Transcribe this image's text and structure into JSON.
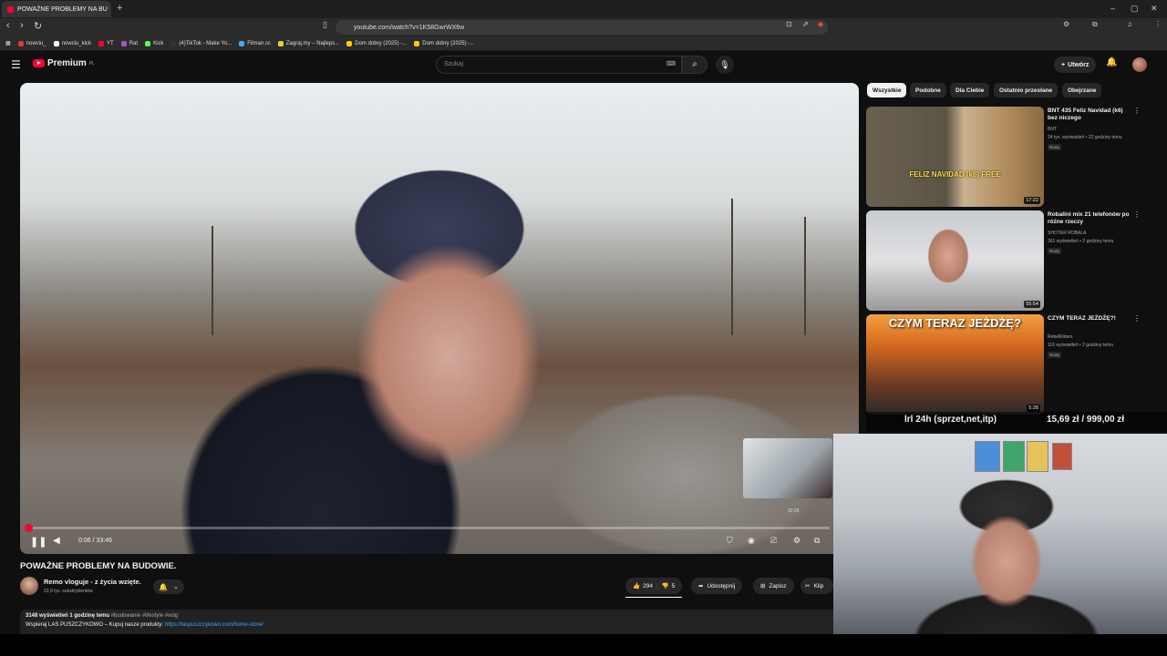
{
  "browser": {
    "tab_title": "POWAŻNE PROBLEMY NA BU",
    "url": "youtube.com/watch?v=1K58GwrWX6w",
    "bookmarks": [
      "nowciu_",
      "nowciu_kick",
      "YT",
      "Rat",
      "Kick",
      "(4)TikTok - Make Yo...",
      "Filman.cc",
      "Zagraj.my – Najleps...",
      "Dom dobry (2025) -...",
      "Dom dobry (2025) -..."
    ]
  },
  "header": {
    "logo_text": "Premium",
    "logo_region": "PL",
    "search_placeholder": "Szukaj",
    "create_label": "Utwórz"
  },
  "player": {
    "time": "0:06 / 33:46",
    "pip_duration": "32:25",
    "progress_fraction": 0.003
  },
  "video": {
    "title": "POWAŻNE PROBLEMY NA BUDOWIE.",
    "channel": "Remo vloguje - z życia wzięte.",
    "subscribers": "23,9 tys. subskrybentów",
    "likes": "294",
    "dislikes": "5",
    "share": "Udostępnij",
    "save": "Zapisz",
    "clip": "Klip",
    "description": {
      "stats": "3148 wyświetleń  1 godzinę temu",
      "tags": "#budowanie #lifestyle #volg",
      "line2": "Wspieraj  LAS PUSZCZYKOWO – Kupuj nasze produkty:",
      "link": "https://laspuszczykowo.com/home-store/"
    }
  },
  "sidebar": {
    "chips": [
      "Wszystkie",
      "Podobne",
      "Dla Ciebie",
      "Ostatnio przesłane",
      "Obejrzane"
    ],
    "videos": [
      {
        "title": "BNT 435 Feliz Navidad (k6) bez niczego",
        "channel": "BNT",
        "meta": "24 tys. wyświetleń • 22 godziny temu",
        "badge": "Nowy",
        "duration": "17:22",
        "thumb_text": "FELIZ NAVIDAD (k6) FREE"
      },
      {
        "title": "Robalini mix 21 telefonów po różne rzeczy",
        "channel": "SHOTER ROBALA",
        "meta": "361 wyświetleń • 2 godziny temu",
        "badge": "Nowy",
        "duration": "55:54",
        "thumb_text": ""
      },
      {
        "title": "CZYM TERAZ JEŻDŻĘ?!",
        "channel": "RebelRiders",
        "meta": "116 wyświetleń • 2 godziny temu",
        "badge": "Nowy",
        "duration": "5:28",
        "thumb_text": "CZYM TERAZ JEŻDŻĘ?"
      }
    ]
  },
  "overlay": {
    "left_text": "lrl 24h (sprzet,net,itp)",
    "right_text": "15,69 zł / 999,00 zł"
  },
  "colors": {
    "accent": "#ff0033",
    "link": "#3ea6ff",
    "background": "#0f0f0f"
  }
}
